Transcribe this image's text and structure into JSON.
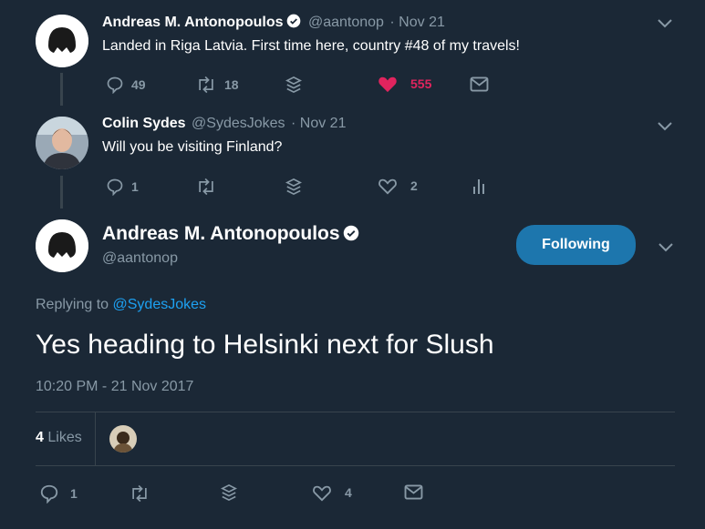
{
  "tweet1": {
    "author_name": "Andreas M. Antonopoulos",
    "handle": "@aantonop",
    "date": "· Nov 21",
    "text": "Landed in Riga Latvia. First time here, country #48 of my travels!",
    "replies": "49",
    "retweets": "18",
    "likes": "555",
    "liked": true
  },
  "tweet2": {
    "author_name": "Colin Sydes",
    "handle": "@SydesJokes",
    "date": "· Nov 21",
    "text": "Will you be visiting Finland?",
    "replies": "1",
    "likes": "2"
  },
  "main": {
    "author_name": "Andreas M. Antonopoulos",
    "handle": "@aantonop",
    "follow_label": "Following",
    "replying_prefix": "Replying to",
    "replying_to": "@SydesJokes",
    "text": "Yes heading to Helsinki next for Slush",
    "timestamp": "10:20 PM - 21 Nov 2017",
    "likes_count": "4",
    "likes_label": "Likes",
    "replies": "1",
    "likes": "4"
  },
  "colors": {
    "background": "#1b2836",
    "accent": "#1da1f2",
    "follow_button": "#1d76ad",
    "like": "#e0245e",
    "muted": "#8899a6"
  }
}
